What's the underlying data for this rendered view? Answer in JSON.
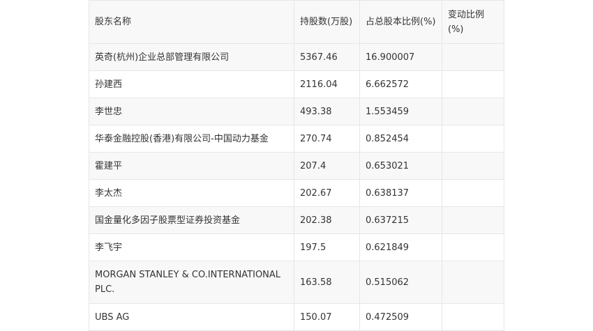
{
  "table": {
    "headers": [
      "股东名称",
      "持股数(万股)",
      "占总股本比例(%)",
      "变动比例(%)"
    ],
    "rows": [
      {
        "name": "英奇(杭州)企业总部管理有限公司",
        "shares": "5367.46",
        "ratio": "16.900007",
        "change": ""
      },
      {
        "name": "孙建西",
        "shares": "2116.04",
        "ratio": "6.662572",
        "change": ""
      },
      {
        "name": "李世忠",
        "shares": "493.38",
        "ratio": "1.553459",
        "change": ""
      },
      {
        "name": "华泰金融控股(香港)有限公司-中国动力基金",
        "shares": "270.74",
        "ratio": "0.852454",
        "change": ""
      },
      {
        "name": "霍建平",
        "shares": "207.4",
        "ratio": "0.653021",
        "change": ""
      },
      {
        "name": "李太杰",
        "shares": "202.67",
        "ratio": "0.638137",
        "change": ""
      },
      {
        "name": "国金量化多因子股票型证券投资基金",
        "shares": "202.38",
        "ratio": "0.637215",
        "change": ""
      },
      {
        "name": "李飞宇",
        "shares": "197.5",
        "ratio": "0.621849",
        "change": ""
      },
      {
        "name": "MORGAN STANLEY & CO.INTERNATIONAL PLC.",
        "shares": "163.58",
        "ratio": "0.515062",
        "change": ""
      },
      {
        "name": "UBS AG",
        "shares": "150.07",
        "ratio": "0.472509",
        "change": ""
      }
    ]
  }
}
